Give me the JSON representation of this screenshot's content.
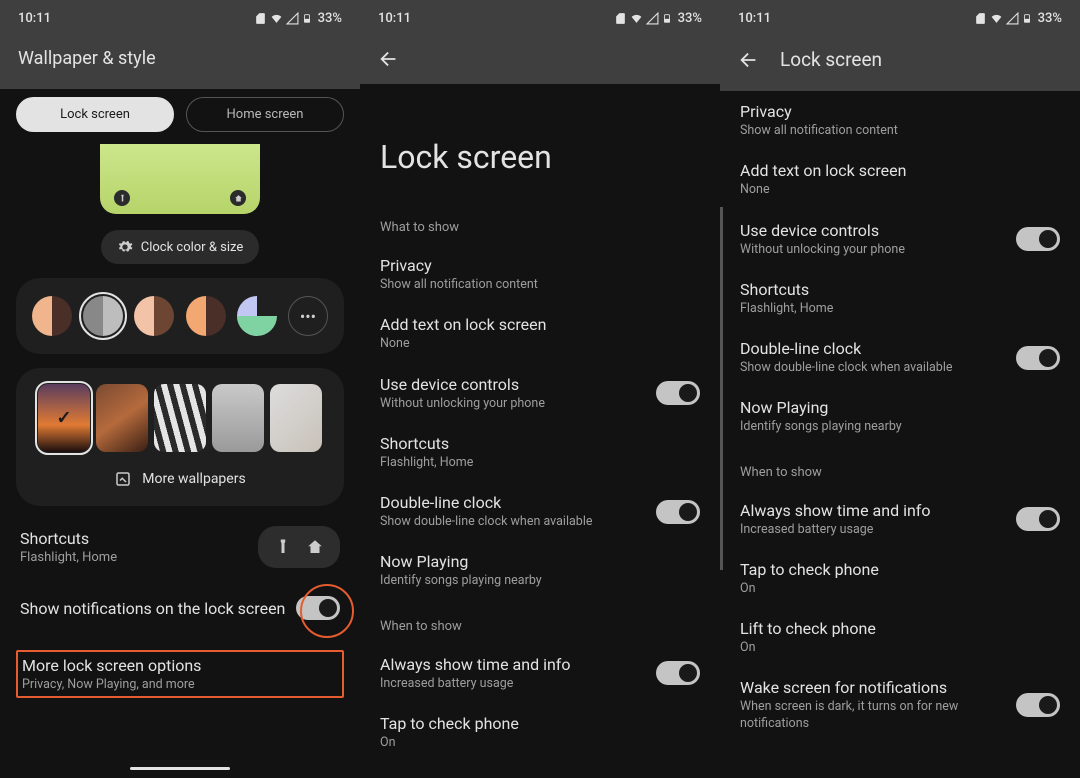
{
  "status": {
    "time": "10:11",
    "battery_pct": "33%"
  },
  "s1": {
    "title": "Wallpaper & style",
    "tab_lock": "Lock screen",
    "tab_home": "Home screen",
    "clock_chip": "Clock color & size",
    "more_wallpapers": "More wallpapers",
    "shortcuts_title": "Shortcuts",
    "shortcuts_value": "Flashlight, Home",
    "notif_label": "Show notifications on the lock screen",
    "more_options_title": "More lock screen options",
    "more_options_sub": "Privacy, Now Playing, and more",
    "palette": [
      {
        "c1": "#f0b58c",
        "c2": "#4a2e28"
      },
      {
        "c1": "#888",
        "c2": "#bdbdbd",
        "selected": true
      },
      {
        "c1": "#f2c3a6",
        "c2": "#6c4533"
      },
      {
        "c1": "#f2a870",
        "c2": "#4a2e28"
      },
      {
        "c1": "#c1c7f2",
        "c2": "#7fd3a2"
      }
    ]
  },
  "s2": {
    "page_title": "Lock screen",
    "section_what": "What to show",
    "section_when": "When to show",
    "rows": [
      {
        "title": "Privacy",
        "sub": "Show all notification content"
      },
      {
        "title": "Add text on lock screen",
        "sub": "None"
      },
      {
        "title": "Use device controls",
        "sub": "Without unlocking your phone",
        "toggle": true
      },
      {
        "title": "Shortcuts",
        "sub": "Flashlight, Home"
      },
      {
        "title": "Double-line clock",
        "sub": "Show double-line clock when available",
        "toggle": true
      },
      {
        "title": "Now Playing",
        "sub": "Identify songs playing nearby"
      },
      {
        "title": "Always show time and info",
        "sub": "Increased battery usage",
        "toggle": true
      },
      {
        "title": "Tap to check phone",
        "sub": "On"
      }
    ]
  },
  "s3": {
    "page_title": "Lock screen",
    "section_when": "When to show",
    "rows": [
      {
        "title": "Privacy",
        "sub": "Show all notification content"
      },
      {
        "title": "Add text on lock screen",
        "sub": "None"
      },
      {
        "title": "Use device controls",
        "sub": "Without unlocking your phone",
        "toggle": true
      },
      {
        "title": "Shortcuts",
        "sub": "Flashlight, Home"
      },
      {
        "title": "Double-line clock",
        "sub": "Show double-line clock when available",
        "toggle": true
      },
      {
        "title": "Now Playing",
        "sub": "Identify songs playing nearby"
      },
      {
        "title": "Always show time and info",
        "sub": "Increased battery usage",
        "toggle": true
      },
      {
        "title": "Tap to check phone",
        "sub": "On"
      },
      {
        "title": "Lift to check phone",
        "sub": "On"
      },
      {
        "title": "Wake screen for notifications",
        "sub": "When screen is dark, it turns on for new notifications",
        "toggle": true
      }
    ]
  }
}
